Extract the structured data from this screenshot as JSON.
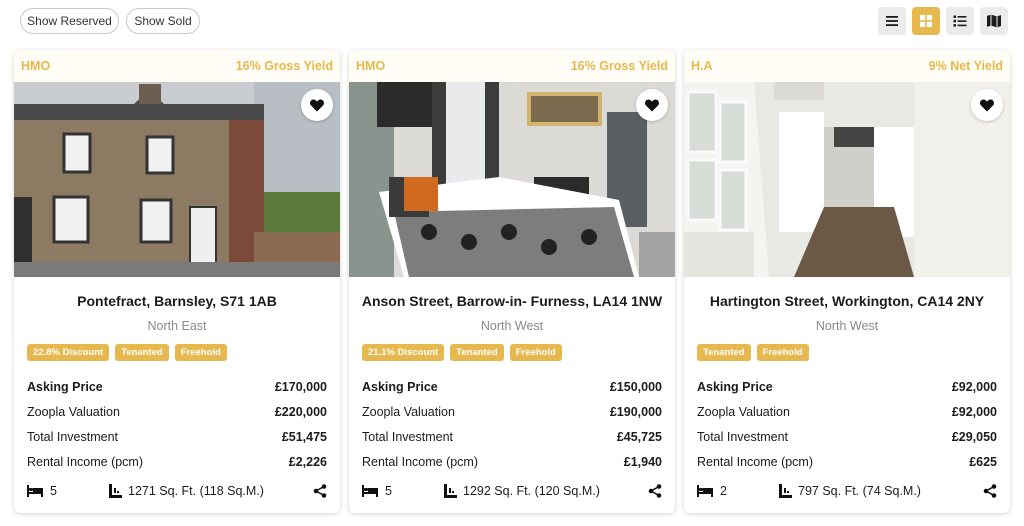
{
  "filters": {
    "show_reserved": "Show Reserved",
    "show_sold": "Show Sold"
  },
  "view_buttons": [
    "list-view",
    "grid-view",
    "detail-list-view",
    "map-view"
  ],
  "accent_color": "#e6b84d",
  "listings": [
    {
      "category": "HMO",
      "yield": "16% Gross Yield",
      "address": "Pontefract, Barnsley, S71 1AB",
      "region": "North East",
      "tags": [
        "22.8% Discount",
        "Tenanted",
        "Freehold"
      ],
      "rows": [
        {
          "label": "Asking Price",
          "value": "£170,000"
        },
        {
          "label": "Zoopla Valuation",
          "value": "£220,000"
        },
        {
          "label": "Total Investment",
          "value": "£51,475"
        },
        {
          "label": "Rental Income (pcm)",
          "value": "£2,226"
        }
      ],
      "beds": "5",
      "area": "1271 Sq. Ft. (118 Sq.M.)"
    },
    {
      "category": "HMO",
      "yield": "16% Gross Yield",
      "address": "Anson Street, Barrow-in- Furness, LA14 1NW",
      "region": "North West",
      "tags": [
        "21.1% Discount",
        "Tenanted",
        "Freehold"
      ],
      "rows": [
        {
          "label": "Asking Price",
          "value": "£150,000"
        },
        {
          "label": "Zoopla Valuation",
          "value": "£190,000"
        },
        {
          "label": "Total Investment",
          "value": "£45,725"
        },
        {
          "label": "Rental Income (pcm)",
          "value": "£1,940"
        }
      ],
      "beds": "5",
      "area": "1292 Sq. Ft. (120 Sq.M.)"
    },
    {
      "category": "H.A",
      "yield": "9% Net Yield",
      "address": "Hartington Street, Workington, CA14 2NY",
      "region": "North West",
      "tags": [
        "Tenanted",
        "Freehold"
      ],
      "rows": [
        {
          "label": "Asking Price",
          "value": "£92,000"
        },
        {
          "label": "Zoopla Valuation",
          "value": "£92,000"
        },
        {
          "label": "Total Investment",
          "value": "£29,050"
        },
        {
          "label": "Rental Income (pcm)",
          "value": "£625"
        }
      ],
      "beds": "2",
      "area": "797 Sq. Ft. (74 Sq.M.)"
    }
  ]
}
